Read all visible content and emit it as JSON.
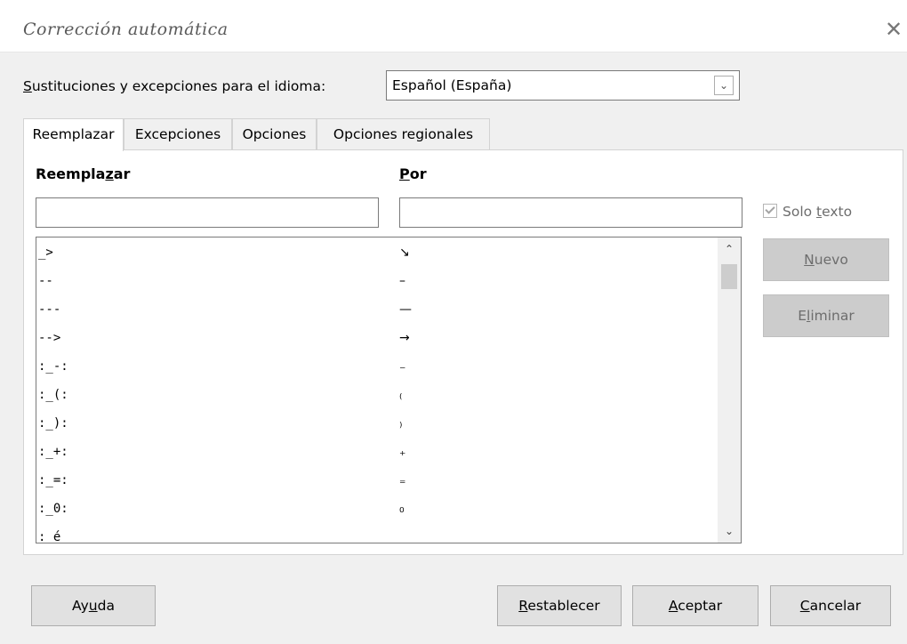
{
  "window": {
    "title": "Corrección automática",
    "close_glyph": "✕"
  },
  "language": {
    "label_before": "",
    "label_u": "S",
    "label_after": "ustituciones y excepciones para el idioma:",
    "selected": "Español (España)",
    "arrow_glyph": "⌄"
  },
  "tabs": [
    {
      "label": "Reemplazar"
    },
    {
      "label": "Excepciones"
    },
    {
      "label": "Opciones"
    },
    {
      "label": "Opciones regionales"
    }
  ],
  "replace": {
    "col1_before": "Reempla",
    "col1_u": "z",
    "col1_after": "ar",
    "col2_u": "P",
    "col2_after": "or",
    "input1_value": "",
    "input2_value": "",
    "text_only_before": "Solo ",
    "text_only_u": "t",
    "text_only_after": "exto",
    "text_only_checked": true,
    "rows": [
      {
        "from": "_>",
        "to": "↘"
      },
      {
        "from": "--",
        "to": "–"
      },
      {
        "from": "---",
        "to": "—"
      },
      {
        "from": "-->",
        "to": "→"
      },
      {
        "from": ":_-:",
        "to": "₋"
      },
      {
        "from": ":_(:",
        "to": "₍"
      },
      {
        "from": ":_):",
        "to": "₎"
      },
      {
        "from": ":_+:",
        "to": "₊"
      },
      {
        "from": ":_=:",
        "to": "₌"
      },
      {
        "from": ":_0:",
        "to": "₀"
      },
      {
        "from": ":_é",
        "to": ""
      }
    ],
    "scroll_up": "⌃",
    "scroll_down": "⌄",
    "new_u": "N",
    "new_after": "uevo",
    "delete_before": "E",
    "delete_u": "l",
    "delete_after": "iminar"
  },
  "footer": {
    "help_before": "Ay",
    "help_u": "u",
    "help_after": "da",
    "reset_u": "R",
    "reset_after": "establecer",
    "ok_u": "A",
    "ok_after": "ceptar",
    "cancel_u": "C",
    "cancel_after": "ancelar"
  }
}
